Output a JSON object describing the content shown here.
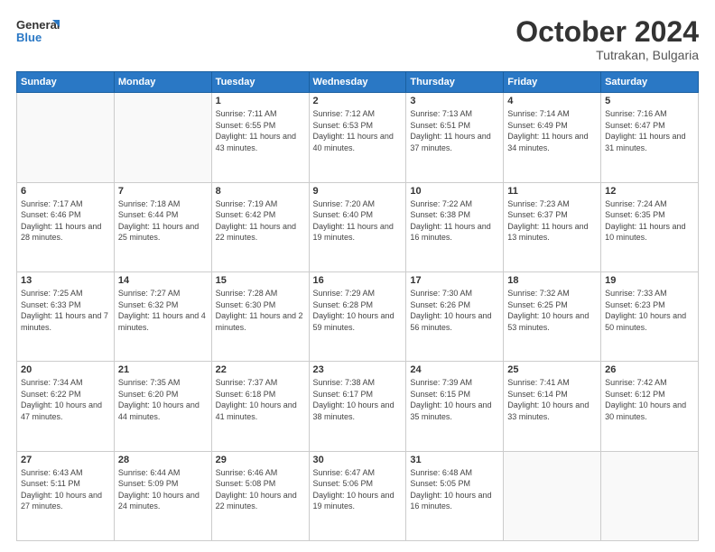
{
  "logo": {
    "line1": "General",
    "line2": "Blue"
  },
  "title": "October 2024",
  "subtitle": "Tutrakan, Bulgaria",
  "days_of_week": [
    "Sunday",
    "Monday",
    "Tuesday",
    "Wednesday",
    "Thursday",
    "Friday",
    "Saturday"
  ],
  "weeks": [
    [
      {
        "day": "",
        "info": ""
      },
      {
        "day": "",
        "info": ""
      },
      {
        "day": "1",
        "info": "Sunrise: 7:11 AM\nSunset: 6:55 PM\nDaylight: 11 hours and 43 minutes."
      },
      {
        "day": "2",
        "info": "Sunrise: 7:12 AM\nSunset: 6:53 PM\nDaylight: 11 hours and 40 minutes."
      },
      {
        "day": "3",
        "info": "Sunrise: 7:13 AM\nSunset: 6:51 PM\nDaylight: 11 hours and 37 minutes."
      },
      {
        "day": "4",
        "info": "Sunrise: 7:14 AM\nSunset: 6:49 PM\nDaylight: 11 hours and 34 minutes."
      },
      {
        "day": "5",
        "info": "Sunrise: 7:16 AM\nSunset: 6:47 PM\nDaylight: 11 hours and 31 minutes."
      }
    ],
    [
      {
        "day": "6",
        "info": "Sunrise: 7:17 AM\nSunset: 6:46 PM\nDaylight: 11 hours and 28 minutes."
      },
      {
        "day": "7",
        "info": "Sunrise: 7:18 AM\nSunset: 6:44 PM\nDaylight: 11 hours and 25 minutes."
      },
      {
        "day": "8",
        "info": "Sunrise: 7:19 AM\nSunset: 6:42 PM\nDaylight: 11 hours and 22 minutes."
      },
      {
        "day": "9",
        "info": "Sunrise: 7:20 AM\nSunset: 6:40 PM\nDaylight: 11 hours and 19 minutes."
      },
      {
        "day": "10",
        "info": "Sunrise: 7:22 AM\nSunset: 6:38 PM\nDaylight: 11 hours and 16 minutes."
      },
      {
        "day": "11",
        "info": "Sunrise: 7:23 AM\nSunset: 6:37 PM\nDaylight: 11 hours and 13 minutes."
      },
      {
        "day": "12",
        "info": "Sunrise: 7:24 AM\nSunset: 6:35 PM\nDaylight: 11 hours and 10 minutes."
      }
    ],
    [
      {
        "day": "13",
        "info": "Sunrise: 7:25 AM\nSunset: 6:33 PM\nDaylight: 11 hours and 7 minutes."
      },
      {
        "day": "14",
        "info": "Sunrise: 7:27 AM\nSunset: 6:32 PM\nDaylight: 11 hours and 4 minutes."
      },
      {
        "day": "15",
        "info": "Sunrise: 7:28 AM\nSunset: 6:30 PM\nDaylight: 11 hours and 2 minutes."
      },
      {
        "day": "16",
        "info": "Sunrise: 7:29 AM\nSunset: 6:28 PM\nDaylight: 10 hours and 59 minutes."
      },
      {
        "day": "17",
        "info": "Sunrise: 7:30 AM\nSunset: 6:26 PM\nDaylight: 10 hours and 56 minutes."
      },
      {
        "day": "18",
        "info": "Sunrise: 7:32 AM\nSunset: 6:25 PM\nDaylight: 10 hours and 53 minutes."
      },
      {
        "day": "19",
        "info": "Sunrise: 7:33 AM\nSunset: 6:23 PM\nDaylight: 10 hours and 50 minutes."
      }
    ],
    [
      {
        "day": "20",
        "info": "Sunrise: 7:34 AM\nSunset: 6:22 PM\nDaylight: 10 hours and 47 minutes."
      },
      {
        "day": "21",
        "info": "Sunrise: 7:35 AM\nSunset: 6:20 PM\nDaylight: 10 hours and 44 minutes."
      },
      {
        "day": "22",
        "info": "Sunrise: 7:37 AM\nSunset: 6:18 PM\nDaylight: 10 hours and 41 minutes."
      },
      {
        "day": "23",
        "info": "Sunrise: 7:38 AM\nSunset: 6:17 PM\nDaylight: 10 hours and 38 minutes."
      },
      {
        "day": "24",
        "info": "Sunrise: 7:39 AM\nSunset: 6:15 PM\nDaylight: 10 hours and 35 minutes."
      },
      {
        "day": "25",
        "info": "Sunrise: 7:41 AM\nSunset: 6:14 PM\nDaylight: 10 hours and 33 minutes."
      },
      {
        "day": "26",
        "info": "Sunrise: 7:42 AM\nSunset: 6:12 PM\nDaylight: 10 hours and 30 minutes."
      }
    ],
    [
      {
        "day": "27",
        "info": "Sunrise: 6:43 AM\nSunset: 5:11 PM\nDaylight: 10 hours and 27 minutes."
      },
      {
        "day": "28",
        "info": "Sunrise: 6:44 AM\nSunset: 5:09 PM\nDaylight: 10 hours and 24 minutes."
      },
      {
        "day": "29",
        "info": "Sunrise: 6:46 AM\nSunset: 5:08 PM\nDaylight: 10 hours and 22 minutes."
      },
      {
        "day": "30",
        "info": "Sunrise: 6:47 AM\nSunset: 5:06 PM\nDaylight: 10 hours and 19 minutes."
      },
      {
        "day": "31",
        "info": "Sunrise: 6:48 AM\nSunset: 5:05 PM\nDaylight: 10 hours and 16 minutes."
      },
      {
        "day": "",
        "info": ""
      },
      {
        "day": "",
        "info": ""
      }
    ]
  ]
}
